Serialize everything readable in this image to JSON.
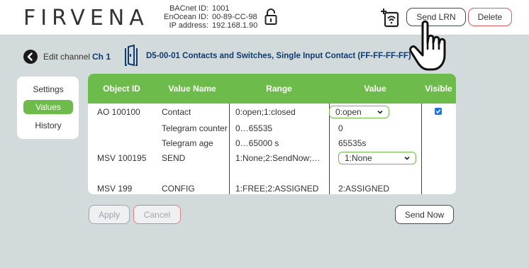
{
  "header": {
    "logo": "FIRVENA",
    "bacnet_label": "BACnet ID:",
    "bacnet_value": "1001",
    "enocean_label": "EnOcean ID:",
    "enocean_value": "00-89-CC-98",
    "ip_label": "IP address:",
    "ip_value": "192.168.1.90",
    "send_lrn": "Send LRN",
    "delete": "Delete"
  },
  "channel": {
    "edit_label": "Edit channel",
    "ch": "Ch 1",
    "profile": "D5-00-01 Contacts and Switches, Single Input Contact (FF-FF-FF-FF)"
  },
  "tabs": [
    "Settings",
    "Values",
    "History"
  ],
  "table": {
    "headers": [
      "Object ID",
      "Value Name",
      "Range",
      "Value",
      "Visible"
    ],
    "rows": [
      {
        "object_id": "AO 100100",
        "name": "Contact",
        "range": "0:open;1:closed",
        "value": "0:open",
        "type": "select",
        "visible": true
      },
      {
        "object_id": "",
        "name": "Telegram counter",
        "range": "0…65535",
        "value": "0",
        "type": "text",
        "visible": false
      },
      {
        "object_id": "",
        "name": "Telegram age",
        "range": "0…65000 s",
        "value": "65535s",
        "type": "text",
        "visible": false
      },
      {
        "object_id": "MSV 100195",
        "name": "SEND",
        "range": "1:None;2:SendNow;…",
        "value": "1:None",
        "type": "select",
        "visible": false
      },
      {
        "object_id": "",
        "name": "",
        "range": "",
        "value": "",
        "type": "text",
        "visible": false
      },
      {
        "object_id": "MSV 199",
        "name": "CONFIG",
        "range": "1:FREE;2:ASSIGNED",
        "value": "2:ASSIGNED",
        "type": "text",
        "visible": false
      }
    ]
  },
  "buttons": {
    "apply": "Apply",
    "cancel": "Cancel",
    "send_now": "Send Now"
  },
  "colors": {
    "accent_green": "#6dbb4a",
    "delete_red": "#e3585c",
    "channel_blue": "#0f3b6e",
    "background": "#d3dadb"
  }
}
